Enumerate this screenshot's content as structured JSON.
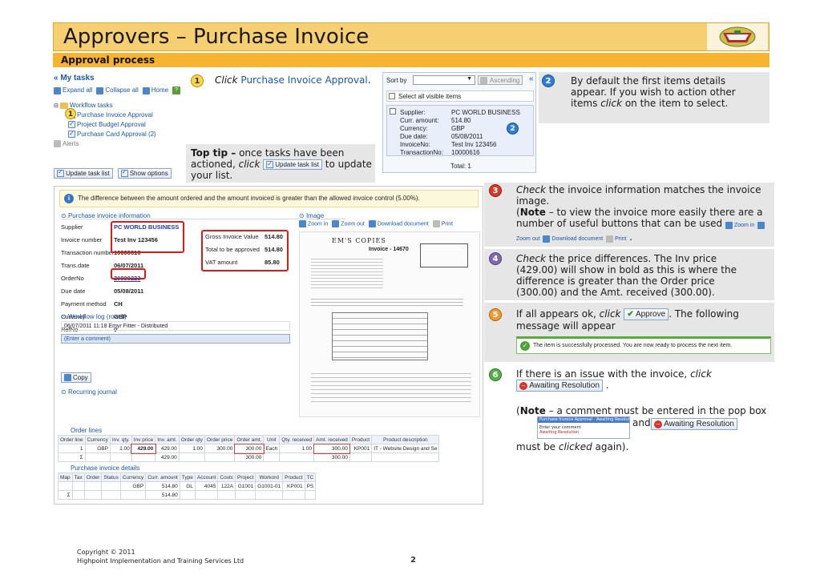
{
  "header": {
    "title": "Approvers – Purchase Invoice",
    "subtitle": "Approval process"
  },
  "mytasks": {
    "title": "« My tasks",
    "toolbar": {
      "expand": "Expand all",
      "collapse": "Collapse all",
      "home": "Home",
      "help": "?"
    },
    "tree": {
      "workflow": "Workflow tasks",
      "items": [
        "Purchase Invoice Approval",
        "Project Budget Approval",
        "Purchase Card Approval (2)"
      ],
      "alerts": "Alerts"
    },
    "buttons": {
      "update": "Update task list",
      "options": "Show options"
    }
  },
  "step1": {
    "num": "1",
    "text_click": "Click",
    "text_link": "Purchase Invoice Approval",
    "text_end": ".",
    "marker": "1"
  },
  "tip": {
    "lead": "Top tip –",
    "t1": "once tasks have been actioned,",
    "t2": "click",
    "btn": "Update task list",
    "t3": "to update your list."
  },
  "sortpanel": {
    "sort_by": "Sort by",
    "ascending": "Ascending",
    "collapse": "«",
    "select_all": "Select all visible items",
    "rows": [
      {
        "k": "Supplier:",
        "v": "PC WORLD BUSINESS"
      },
      {
        "k": "Curr. amount:",
        "v": "514.80"
      },
      {
        "k": "Currency:",
        "v": "GBP"
      },
      {
        "k": "Due date:",
        "v": "05/08/2011"
      },
      {
        "k": "InvoiceNo:",
        "v": "Test Inv 123456"
      },
      {
        "k": "TransactionNo:",
        "v": "10000616"
      }
    ],
    "total": "Total: 1",
    "marker": "2"
  },
  "step2": {
    "num": "2",
    "text": "By default the first items details appear. If you wish to action other items",
    "click": "click",
    "text_end": "on the item to select."
  },
  "step3": {
    "num": "3",
    "check": "Check",
    "t1": "the invoice information matches the invoice image.",
    "note_open": "(",
    "note": "Note",
    "t2": "– to view the invoice more easily there are a number of useful buttons that can be used",
    "btns": [
      "Zoom in",
      "Zoom out",
      "Download document",
      "Print"
    ],
    "end": "."
  },
  "step4": {
    "num": "4",
    "check": "Check",
    "text": "the price differences. The Inv price (429.00) will show in bold as this is where the difference is greater than the Order price (300.00) and the Amt. received (300.00)."
  },
  "step5": {
    "num": "5",
    "t1": "If all appears ok,",
    "click": "click",
    "btn": "Approve",
    "t2": ". The following message will appear",
    "msg": "The item is successfully processed. You are now ready to process the next item."
  },
  "step6": {
    "num": "6",
    "t1": "If there is an issue with the invoice,",
    "click": "click",
    "btn": "Awaiting Resolution",
    "t2": ".",
    "note_open": "(",
    "note": "Note",
    "t3": "– a comment must be entered in the pop box",
    "popup_title": "Purchase Invoice Approval - Awaiting Resolution",
    "popup_lbl": "Enter your comment",
    "popup_btn": "Awaiting Resolution",
    "and": "and",
    "btn2": "Awaiting Resolution",
    "t4": "must be",
    "clicked": "clicked",
    "t5": "again)."
  },
  "main": {
    "warning": "The difference between the amount ordered and the amount invoiced is greater than the allowed invoice control (5.00%).",
    "sec_info": "Purchase invoice information",
    "sec_image": "Image",
    "img_tools": [
      "Zoom in",
      "Zoom out",
      "Download document",
      "Print"
    ],
    "fields": [
      {
        "k": "Supplier",
        "v": "PC WORLD BUSINESS"
      },
      {
        "k": "Invoice number",
        "v": "Test Inv 123456"
      },
      {
        "k": "Transaction number",
        "v": "10000616"
      },
      {
        "k": "Trans.date",
        "v": "06/07/2011"
      },
      {
        "k": "OrderNo",
        "v": "20000223"
      },
      {
        "k": "Due date",
        "v": "05/08/2011"
      },
      {
        "k": "Payment method",
        "v": "CH"
      },
      {
        "k": "Currency",
        "v": "GBP"
      },
      {
        "k": "RefNo",
        "v": "0"
      }
    ],
    "amounts": [
      {
        "k": "Gross Invoice Value",
        "v": "514.80"
      },
      {
        "k": "Total to be approved",
        "v": "514.80"
      },
      {
        "k": "VAT amount",
        "v": "85.80"
      }
    ],
    "workflow_log": "Workflow log (row 1)",
    "log_entry": "06/07/2011 11:18 Emyr Fitter - Distributed",
    "comment_placeholder": "(Enter a comment)",
    "copy": "Copy",
    "recurring": "Recurring journal",
    "order_lines": "Order lines",
    "order_headers": [
      "Order line",
      "Currency",
      "Inv. qty.",
      "Inv price",
      "Inv. amt.",
      "Order qty",
      "Order price",
      "Order amt.",
      "Unit",
      "Qty. received",
      "Amt. received",
      "Product",
      "Product description"
    ],
    "order_row": [
      "1",
      "GBP",
      "1.00",
      "429.00",
      "429.00",
      "1.00",
      "300.00",
      "300.00",
      "Each",
      "1.00",
      "300.00",
      "KP001",
      "IT - Website Design and Se"
    ],
    "order_sum": [
      "Σ",
      "",
      "",
      "",
      "429.00",
      "",
      "",
      "300.00",
      "",
      "",
      "300.00",
      "",
      ""
    ],
    "details": "Purchase invoice details",
    "detail_headers": [
      "Map",
      "Tax",
      "Order",
      "Status",
      "Currency",
      "Curr. amount",
      "Type",
      "Account",
      "Costc",
      "Project",
      "Workord",
      "Product",
      "TC"
    ],
    "detail_row": [
      "",
      "",
      "",
      "",
      "GBP",
      "514.80",
      "GL",
      "4045",
      "122A",
      "G1001",
      "G1001-01",
      "KP001",
      "PS"
    ],
    "detail_sum": [
      "Σ",
      "",
      "",
      "",
      "",
      "514.80",
      "",
      "",
      "",
      "",
      "",
      "",
      ""
    ],
    "invoice_doc": {
      "supplier_hand": "EM'S COPIES",
      "title": "Invoice - 14670"
    }
  },
  "footer": {
    "copyright": "Copyright © 2011",
    "company": "Highpoint Implementation and Training Services Ltd",
    "page": "2"
  }
}
